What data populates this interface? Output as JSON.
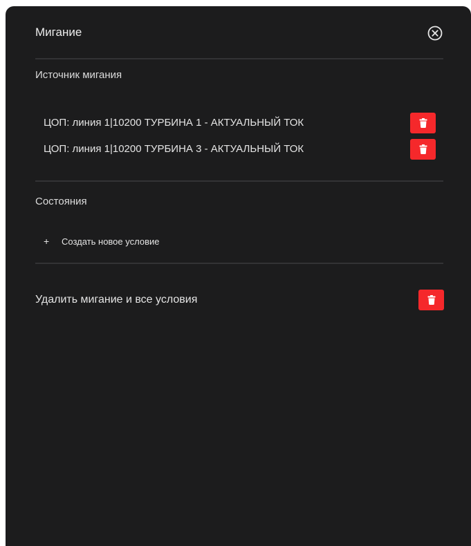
{
  "dialog": {
    "title": "Мигание",
    "close_icon": "close-circle-icon"
  },
  "source_section": {
    "title": "Источник мигания",
    "items": [
      {
        "label": "ЦОП: линия 1|10200 ТУРБИНА 1 - АКТУАЛЬНЫЙ ТОК",
        "delete_icon": "trash-icon"
      },
      {
        "label": "ЦОП: линия 1|10200 ТУРБИНА 3 - АКТУАЛЬНЫЙ ТОК",
        "delete_icon": "trash-icon"
      }
    ]
  },
  "states_section": {
    "title": "Состояния",
    "add_icon": "+",
    "add_label": "Создать новое условие"
  },
  "delete_all": {
    "label": "Удалить мигание и все условия",
    "delete_icon": "trash-icon"
  },
  "colors": {
    "background": "#1c1c1d",
    "danger": "#f5282b",
    "divider": "#333335",
    "text": "#e4e4e4"
  }
}
